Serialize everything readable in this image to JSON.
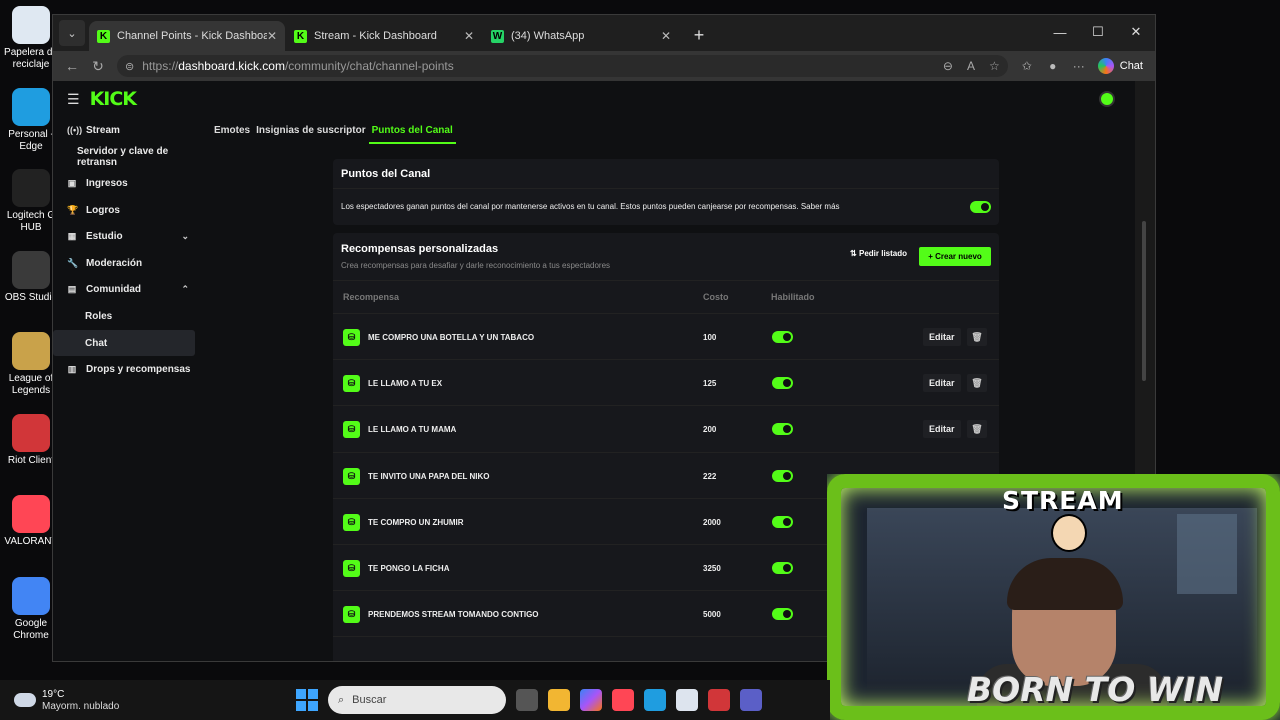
{
  "desktop": {
    "icons": [
      {
        "label": "Papelera de reciclaje",
        "color": "#dfe8f2"
      },
      {
        "label": "Personal - Edge",
        "color": "#1f9de0"
      },
      {
        "label": "Logitech G HUB",
        "color": "#222222"
      },
      {
        "label": "OBS Studio",
        "color": "#3a3a3a"
      },
      {
        "label": "League of Legends",
        "color": "#c9a24a"
      },
      {
        "label": "Riot Client",
        "color": "#d13639"
      },
      {
        "label": "VALORANT",
        "color": "#ff4655"
      },
      {
        "label": "Google Chrome",
        "color": "#4285f4"
      }
    ]
  },
  "browser": {
    "tabs": [
      {
        "title": "Channel Points - Kick Dashboard",
        "favicon": "K",
        "fav_color": "#53fc18"
      },
      {
        "title": "Stream - Kick Dashboard",
        "favicon": "K",
        "fav_color": "#53fc18"
      },
      {
        "title": "(34) WhatsApp",
        "favicon": "W",
        "fav_color": "#25d366"
      }
    ],
    "url_prefix": "https://",
    "url_host": "dashboard.kick.com",
    "url_path": "/community/chat/channel-points",
    "chat_label": "Chat"
  },
  "app": {
    "logo": "KICK",
    "sidebar": [
      {
        "label": "Stream",
        "icon": "((•))",
        "kind": "item"
      },
      {
        "label": "Servidor y clave de retransn",
        "kind": "plain"
      },
      {
        "label": "Ingresos",
        "icon": "▣",
        "kind": "item"
      },
      {
        "label": "Logros",
        "icon": "🏆",
        "kind": "item"
      },
      {
        "label": "Estudio",
        "icon": "▦",
        "kind": "item",
        "chevron": "⌄"
      },
      {
        "label": "Moderación",
        "icon": "🔧",
        "kind": "item"
      },
      {
        "label": "Comunidad",
        "icon": "▤",
        "kind": "item",
        "chevron": "⌃"
      },
      {
        "label": "Roles",
        "kind": "sub"
      },
      {
        "label": "Chat",
        "kind": "sub",
        "selected": true
      },
      {
        "label": "Drops y recompensas",
        "icon": "▥",
        "kind": "item"
      }
    ],
    "subtabs": [
      "Emotes",
      "Insignias de suscriptor",
      "Puntos del Canal"
    ],
    "active_subtab": "Puntos del Canal",
    "points_card": {
      "title": "Puntos del Canal",
      "description": "Los espectadores ganan puntos del canal por mantenerse activos en tu canal. Estos puntos pueden canjearse por recompensas. Saber más",
      "enabled": true
    },
    "rewards_card": {
      "title": "Recompensas personalizadas",
      "subtitle": "Crea recompensas para desafiar y darle reconocimiento a tus espectadores",
      "order_label": "Pedir listado",
      "create_label": "+ Crear nuevo",
      "col_reward": "Recompensa",
      "col_cost": "Costo",
      "col_enabled": "Habilitado",
      "edit_label": "Editar",
      "rows": [
        {
          "name": "ME COMPRO UNA BOTELLA Y UN TABACO",
          "cost": "100",
          "enabled": true,
          "show_actions": true
        },
        {
          "name": "LE LLAMO A TU EX",
          "cost": "125",
          "enabled": true,
          "show_actions": true
        },
        {
          "name": "LE LLAMO A TU MAMA",
          "cost": "200",
          "enabled": true,
          "show_actions": true
        },
        {
          "name": "TE INVITO UNA PAPA DEL NIKO",
          "cost": "222",
          "enabled": true,
          "show_actions": false
        },
        {
          "name": "TE COMPRO UN ZHUMIR",
          "cost": "2000",
          "enabled": true,
          "show_actions": false
        },
        {
          "name": "TE PONGO LA FICHA",
          "cost": "3250",
          "enabled": true,
          "show_actions": false
        },
        {
          "name": "PRENDEMOS STREAM TOMANDO CONTIGO",
          "cost": "5000",
          "enabled": true,
          "show_actions": false
        }
      ]
    }
  },
  "overlay": {
    "stream_label": "STREAM",
    "slogan": "BORN TO WIN"
  },
  "taskbar": {
    "temperature": "19°C",
    "weather": "Mayorm. nublado",
    "search_placeholder": "Buscar"
  }
}
